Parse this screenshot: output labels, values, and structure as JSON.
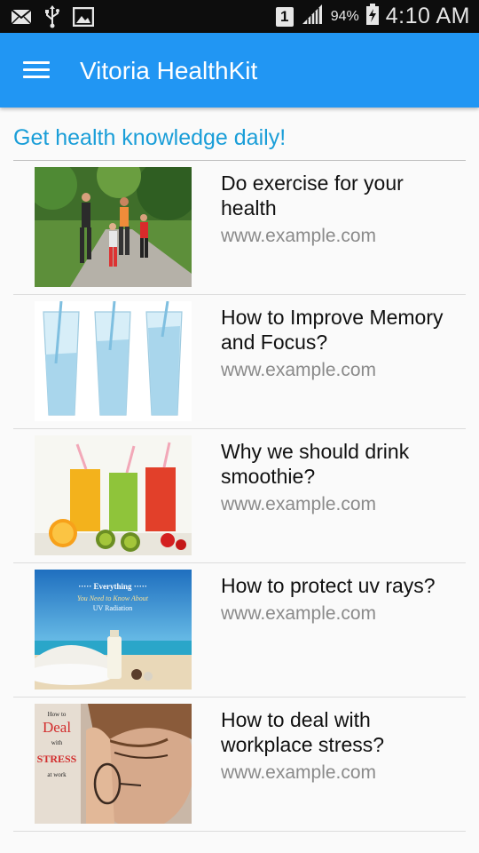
{
  "status_bar": {
    "icons": [
      "email-icon",
      "usb-icon",
      "image-icon"
    ],
    "sim_slot": "1",
    "battery_percent": "94%",
    "time": "4:10 AM"
  },
  "app_bar": {
    "menu_icon": "hamburger-menu-icon",
    "title": "Vitoria HealthKit"
  },
  "main": {
    "heading": "Get health knowledge daily!",
    "articles": [
      {
        "title": "Do exercise for your health",
        "url": "www.example.com",
        "image": "family-jogging-photo"
      },
      {
        "title": "How to Improve Memory and Focus?",
        "url": "www.example.com",
        "image": "water-glasses-photo"
      },
      {
        "title": "Why we should drink smoothie?",
        "url": "www.example.com",
        "image": "smoothie-glasses-photo"
      },
      {
        "title": "How to protect uv rays?",
        "url": "www.example.com",
        "image": "uv-radiation-beach-photo",
        "image_text": [
          "Everything",
          "You Need to Know About",
          "UV Radiation"
        ]
      },
      {
        "title": "How to deal with workplace stress?",
        "url": "www.example.com",
        "image": "stressed-woman-photo",
        "image_text": [
          "How to",
          "Deal",
          "with",
          "STRESS",
          "at work"
        ]
      }
    ]
  },
  "colors": {
    "app_bar": "#2196f3",
    "heading": "#1a9ed8",
    "status_bar": "#0d0d0d"
  }
}
